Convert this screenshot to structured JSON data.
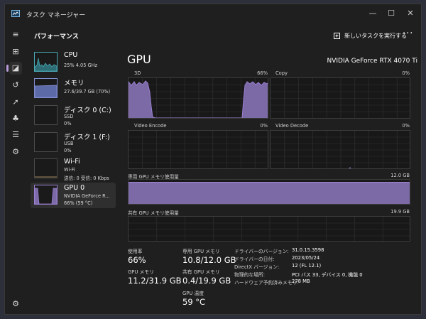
{
  "window": {
    "title": "タスク マネージャー",
    "minimize": "—",
    "maximize": "☐",
    "close": "✕"
  },
  "rail": {
    "menu": "≡",
    "processes": "⊞",
    "performance": "◪",
    "history": "↺",
    "startup": "➚",
    "users": "♣",
    "details": "☰",
    "services": "⚙",
    "settings": "⚙"
  },
  "header": {
    "title": "パフォーマンス",
    "run_task": "新しいタスクを実行する",
    "more": "···"
  },
  "sidebar": {
    "items": [
      {
        "name": "CPU",
        "sub1": "25% 4.05 GHz",
        "sub2": ""
      },
      {
        "name": "メモリ",
        "sub1": "27.6/39.7 GB (70%)",
        "sub2": ""
      },
      {
        "name": "ディスク 0 (C:)",
        "sub1": "SSD",
        "sub2": "0%"
      },
      {
        "name": "ディスク 1 (F:)",
        "sub1": "USB",
        "sub2": "0%"
      },
      {
        "name": "Wi-Fi",
        "sub1": "Wi-Fi",
        "sub2": "送信: 0 受信: 0 Kbps"
      },
      {
        "name": "GPU 0",
        "sub1": "NVIDIA GeForce R...",
        "sub2": "66% (59 °C)"
      }
    ],
    "levels": {
      "cpu": 0.25,
      "memory": 0.7,
      "disk0": 0.0,
      "disk1": 0.0,
      "gpu": 0.66
    }
  },
  "main": {
    "title": "GPU",
    "model": "NVIDIA GeForce RTX 4070 Ti",
    "engines": [
      {
        "name": "3D",
        "value": "66%"
      },
      {
        "name": "Copy",
        "value": "0%"
      },
      {
        "name": "Video Encode",
        "value": "0%"
      },
      {
        "name": "Video Decode",
        "value": "0%"
      }
    ],
    "dedicated": {
      "label": "専用 GPU メモリ使用量",
      "max": "12.0 GB",
      "level": 0.9
    },
    "shared": {
      "label": "共有 GPU メモリ使用量",
      "max": "19.9 GB",
      "level": 0.02
    },
    "stats": {
      "util_label": "使用率",
      "util_value": "66%",
      "gpu_mem_label": "GPU メモリ",
      "gpu_mem_value": "11.2/31.9 GB",
      "ded_label": "専用 GPU メモリ",
      "ded_value": "10.8/12.0 GB",
      "shared_label": "共有 GPU メモリ",
      "shared_value": "0.4/19.9 GB",
      "temp_label": "GPU 温度",
      "temp_value": "59 °C"
    },
    "info": [
      {
        "label": "ドライバーのバージョン:",
        "value": "31.0.15.3598"
      },
      {
        "label": "ドライバーの日付:",
        "value": "2023/05/24"
      },
      {
        "label": "DirectX バージョン:",
        "value": "12 (FL 12.1)"
      },
      {
        "label": "物理的な場所:",
        "value": "PCI バス 33, デバイス 0, 機能 0"
      },
      {
        "label": "ハードウェア予約済みメモリ:",
        "value": "278 MB"
      }
    ]
  },
  "colors": {
    "accent": "#9b7fd1",
    "accent_fill": "#7b6aa6",
    "cpu": "#49a9b4",
    "memory": "#7f8ccf",
    "background": "#1f1f1f"
  }
}
